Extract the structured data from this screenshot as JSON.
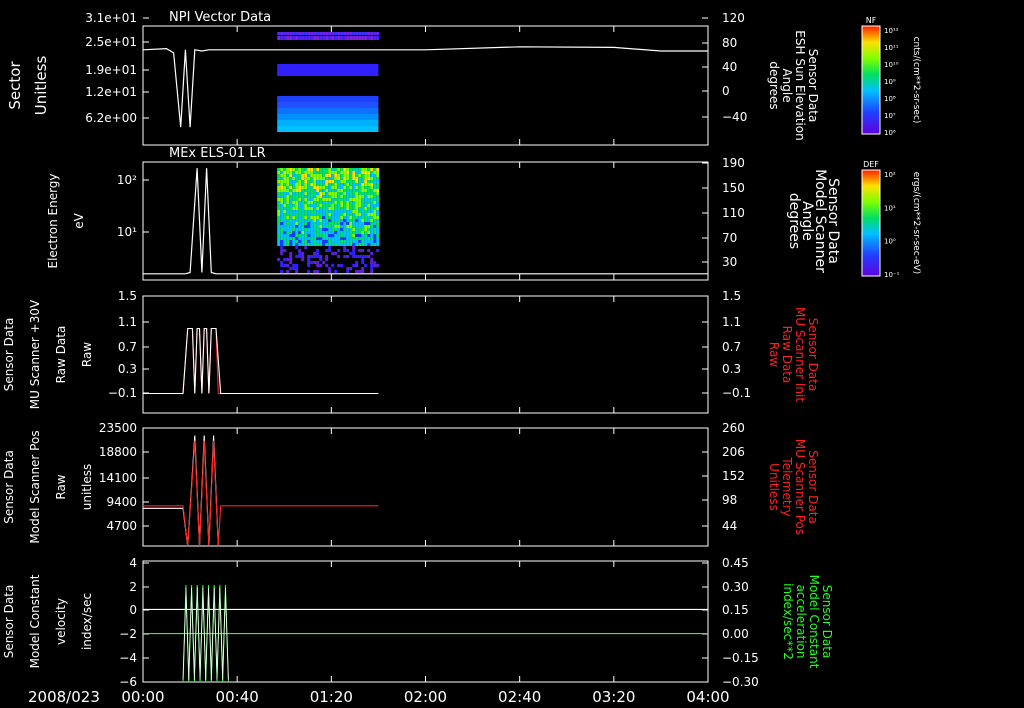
{
  "time_axis": {
    "date_label": "2008/023",
    "ticks": [
      "00:00",
      "00:40",
      "01:20",
      "02:00",
      "02:40",
      "03:20",
      "04:00"
    ],
    "range_minutes": [
      0,
      240
    ]
  },
  "colorbars": [
    {
      "title": "NF",
      "unit_label": "cnts/(cm**2-sr-sec)",
      "ticks": [
        "10¹²",
        "10¹¹",
        "10¹⁰",
        "10⁹",
        "10⁸",
        "10⁷",
        "10⁶"
      ]
    },
    {
      "title": "DEF",
      "unit_label": "ergs/(cm**2-sr-sec-eV)",
      "ticks": [
        "10²",
        "10¹",
        "10⁰",
        "10⁻¹"
      ]
    }
  ],
  "chart_data": [
    {
      "type": "heatmap",
      "title": "NPI Vector Data",
      "ylabel": [
        "Sector",
        "Unitless"
      ],
      "yticks": [
        "3.1e+01",
        "2.5e+01",
        "1.9e+01",
        "1.2e+01",
        "6.2e+00"
      ],
      "y2label": [
        "Sensor Data",
        "ESH Sun Elevation",
        "Angle",
        "degrees"
      ],
      "y2ticks": [
        "120",
        "80",
        "40",
        "0",
        "−40"
      ],
      "y2lim": [
        -80,
        120
      ],
      "line_series": {
        "name": "ESH Sun Elevation Angle",
        "x": [
          0,
          10,
          13,
          16,
          18,
          20,
          22,
          25,
          28,
          30,
          60,
          120,
          160,
          200,
          220,
          240
        ],
        "y": [
          80,
          82,
          75,
          -50,
          80,
          -50,
          80,
          78,
          80,
          80,
          80,
          80,
          85,
          84,
          78,
          78
        ]
      },
      "heatmap_extent_minutes": [
        57,
        100
      ]
    },
    {
      "type": "heatmap",
      "title": "MEx ELS-01 LR",
      "ylabel": [
        "Electron Energy",
        "eV"
      ],
      "yticks": [
        "10²",
        "10¹"
      ],
      "y2label": [
        "Sensor Data",
        "Model Scanner",
        "Angle",
        "degrees"
      ],
      "y2ticks": [
        "190",
        "150",
        "110",
        "70",
        "30"
      ],
      "y2lim": [
        0,
        190
      ],
      "line_series": {
        "name": "Model Scanner Angle",
        "x": [
          0,
          18,
          20,
          23,
          25,
          27,
          29,
          31,
          33,
          240
        ],
        "y": [
          10,
          10,
          12,
          180,
          12,
          180,
          12,
          10,
          10,
          10
        ]
      },
      "heatmap_extent_minutes": [
        57,
        100
      ]
    },
    {
      "type": "line",
      "yticks": [
        "1.5",
        "1.1",
        "0.7",
        "0.3",
        "−0.1"
      ],
      "ylim": [
        -0.3,
        1.5
      ],
      "ylabel": [
        "Sensor Data",
        "MU Scanner +30V",
        "Raw Data",
        "Raw"
      ],
      "y2ticks": [
        "1.5",
        "1.1",
        "0.7",
        "0.3",
        "−0.1"
      ],
      "y2label": [
        "Sensor Data",
        "MU Scanner Init",
        "Raw Data",
        "Raw"
      ],
      "series": [
        {
          "name": "MU Scanner Init",
          "x": [
            0,
            17,
            19,
            21,
            22,
            23,
            24,
            25,
            26,
            27,
            28,
            29,
            30,
            31,
            32,
            33,
            35,
            100
          ],
          "y": [
            0,
            0,
            1,
            1,
            0,
            1,
            1,
            0,
            1,
            1,
            0,
            1,
            1,
            1,
            0,
            0,
            0,
            0
          ]
        },
        {
          "name": "MU Scanner +30V",
          "x": [
            0,
            17,
            19,
            21,
            22,
            23,
            24,
            25,
            26,
            27,
            28,
            29,
            30,
            31,
            33,
            35,
            100
          ],
          "y": [
            0,
            0,
            1,
            1,
            0,
            1,
            1,
            0,
            1,
            1,
            0,
            1,
            1,
            1,
            0,
            0,
            0
          ]
        }
      ]
    },
    {
      "type": "line",
      "yticks": [
        "23500",
        "18800",
        "14100",
        "9400",
        "4700"
      ],
      "ylim": [
        0,
        23500
      ],
      "ylabel": [
        "Sensor Data",
        "Model Scanner Pos",
        "Raw",
        "unitless"
      ],
      "y2ticks": [
        "260",
        "206",
        "152",
        "98",
        "44"
      ],
      "y2label": [
        "Sensor Data",
        "MU Scanner Pos",
        "Telemetry",
        "Unitless"
      ],
      "series": [
        {
          "name": "Model Scanner Pos",
          "x": [
            0,
            17,
            19,
            22,
            24,
            26,
            28,
            30,
            32,
            34,
            36,
            240
          ],
          "y": [
            7500,
            7500,
            0,
            22000,
            0,
            22000,
            0,
            22000,
            0,
            0,
            0,
            0
          ]
        },
        {
          "name": "MU Scanner Pos",
          "x": [
            0,
            17,
            19,
            22,
            24,
            26,
            28,
            30,
            32,
            33,
            35,
            100
          ],
          "y": [
            8000,
            8000,
            0,
            21000,
            0,
            21000,
            0,
            21000,
            0,
            8000,
            8000,
            8000
          ]
        }
      ]
    },
    {
      "type": "line",
      "yticks": [
        "4",
        "2",
        "0",
        "−2",
        "−4",
        "−6"
      ],
      "ylim": [
        -6,
        4
      ],
      "ylabel": [
        "Sensor Data",
        "Model Constant",
        "velocity",
        "index/sec"
      ],
      "y2ticks": [
        "0.45",
        "0.30",
        "0.15",
        "0.00",
        "−0.15",
        "−0.30"
      ],
      "y2label": [
        "Sensor Data",
        "Model Constant",
        "acceleration",
        "index/sec**2"
      ],
      "series": [
        {
          "name": "velocity",
          "x": [
            0,
            240
          ],
          "y": [
            0,
            0
          ]
        },
        {
          "name": "acceleration",
          "x": [
            0,
            240
          ],
          "y": [
            -2,
            -2
          ]
        }
      ]
    }
  ]
}
